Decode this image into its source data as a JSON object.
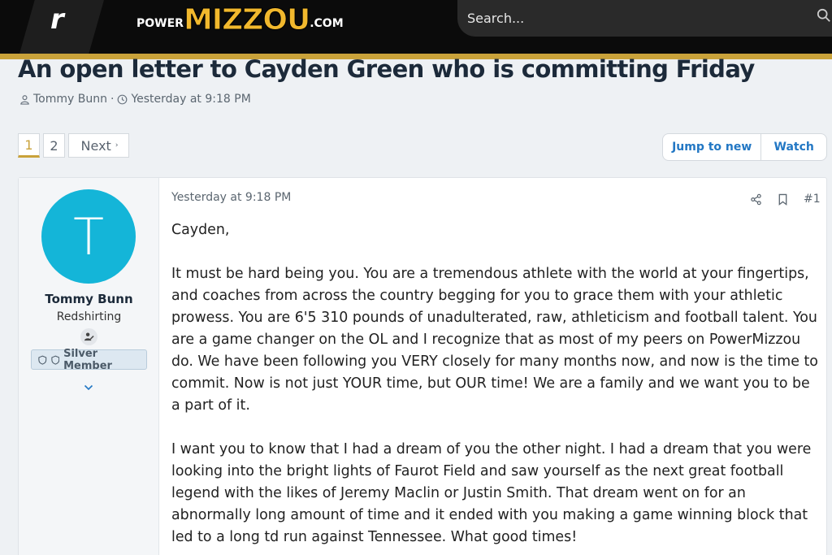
{
  "header": {
    "site_logo_letter": "r",
    "brand_prefix": "POWER",
    "brand_main": "MIZZOU",
    "brand_suffix": ".COM",
    "search_placeholder": "Search..."
  },
  "thread": {
    "title": "An open letter to Cayden Green who is committing Friday",
    "author": "Tommy Bunn",
    "separator": "·",
    "posted": "Yesterday at 9:18 PM"
  },
  "pagination": {
    "pages": [
      "1",
      "2"
    ],
    "current": "1",
    "next_label": "Next",
    "next_caret": "›"
  },
  "actions": {
    "jump_label": "Jump to new",
    "watch_label": "Watch"
  },
  "post": {
    "avatar_letter": "T",
    "avatar_color": "#14b5d8",
    "user_name": "Tommy Bunn",
    "user_title": "Redshirting",
    "user_banner": "Silver Member",
    "date": "Yesterday at 9:18 PM",
    "post_number": "#1",
    "paragraphs": [
      "Cayden,",
      "It must be hard being you. You are a tremendous athlete with the world at your fingertips, and coaches from across the country begging for you to grace them with your athletic prowess. You are 6'5 310 pounds of unadulterated, raw, athleticism and football talent. You are a game changer on the OL and I recognize that as most of my peers on PowerMizzou do. We have been following you VERY closely for many months now, and now is the time to commit. Now is not just YOUR time, but OUR time! We are a family and we want you to be a part of it.",
      "I want you to know that I had a dream of you the other night. I had a dream that you were looking into the bright lights of Faurot Field and saw yourself as the next great football legend with the likes of Jeremy Maclin or Justin Smith. That dream went on for an abnormally long amount of time and it ended with you making a game winning block that led to a long td run against Tennessee. What good times!"
    ]
  },
  "colors": {
    "brand_gold": "#f1b82d",
    "accent_link": "#2277c4",
    "page_bg": "#eef1f4"
  }
}
